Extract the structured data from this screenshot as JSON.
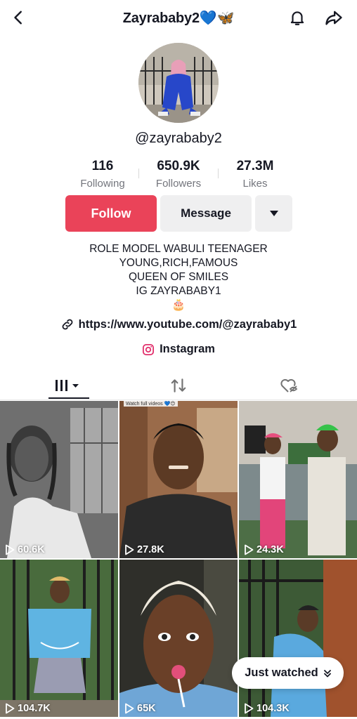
{
  "header": {
    "title": "Zayrababy2💙🦋"
  },
  "profile": {
    "username": "@zayrababy2",
    "stats": [
      {
        "value": "116",
        "label": "Following"
      },
      {
        "value": "650.9K",
        "label": "Followers"
      },
      {
        "value": "27.3M",
        "label": "Likes"
      }
    ],
    "follow_label": "Follow",
    "message_label": "Message",
    "bio_lines": [
      "ROLE MODEL WABULI TEENAGER",
      "YOUNG,RICH,FAMOUS",
      "QUEEN OF SMILES",
      "IG ZAYRABABY1"
    ],
    "bio_emoji": "🎂",
    "link": "https://www.youtube.com/@zayrababy1",
    "instagram_label": "Instagram"
  },
  "tabs": [
    {
      "name": "videos",
      "icon": "grid-bars-icon",
      "active": true
    },
    {
      "name": "reposts",
      "icon": "repost-icon",
      "active": false
    },
    {
      "name": "liked",
      "icon": "liked-hidden-icon",
      "active": false
    }
  ],
  "videos": [
    {
      "views": "60.6K"
    },
    {
      "views": "27.8K",
      "caption": "Watch full videos 💙😊"
    },
    {
      "views": "24.3K"
    },
    {
      "views": "104.7K"
    },
    {
      "views": "65K"
    },
    {
      "views": "104.3K"
    }
  ],
  "overlay": {
    "just_watched_label": "Just watched"
  },
  "colors": {
    "follow": "#ea4359",
    "secondary_button": "#efeff0",
    "text": "#161823",
    "muted": "#73757c"
  }
}
